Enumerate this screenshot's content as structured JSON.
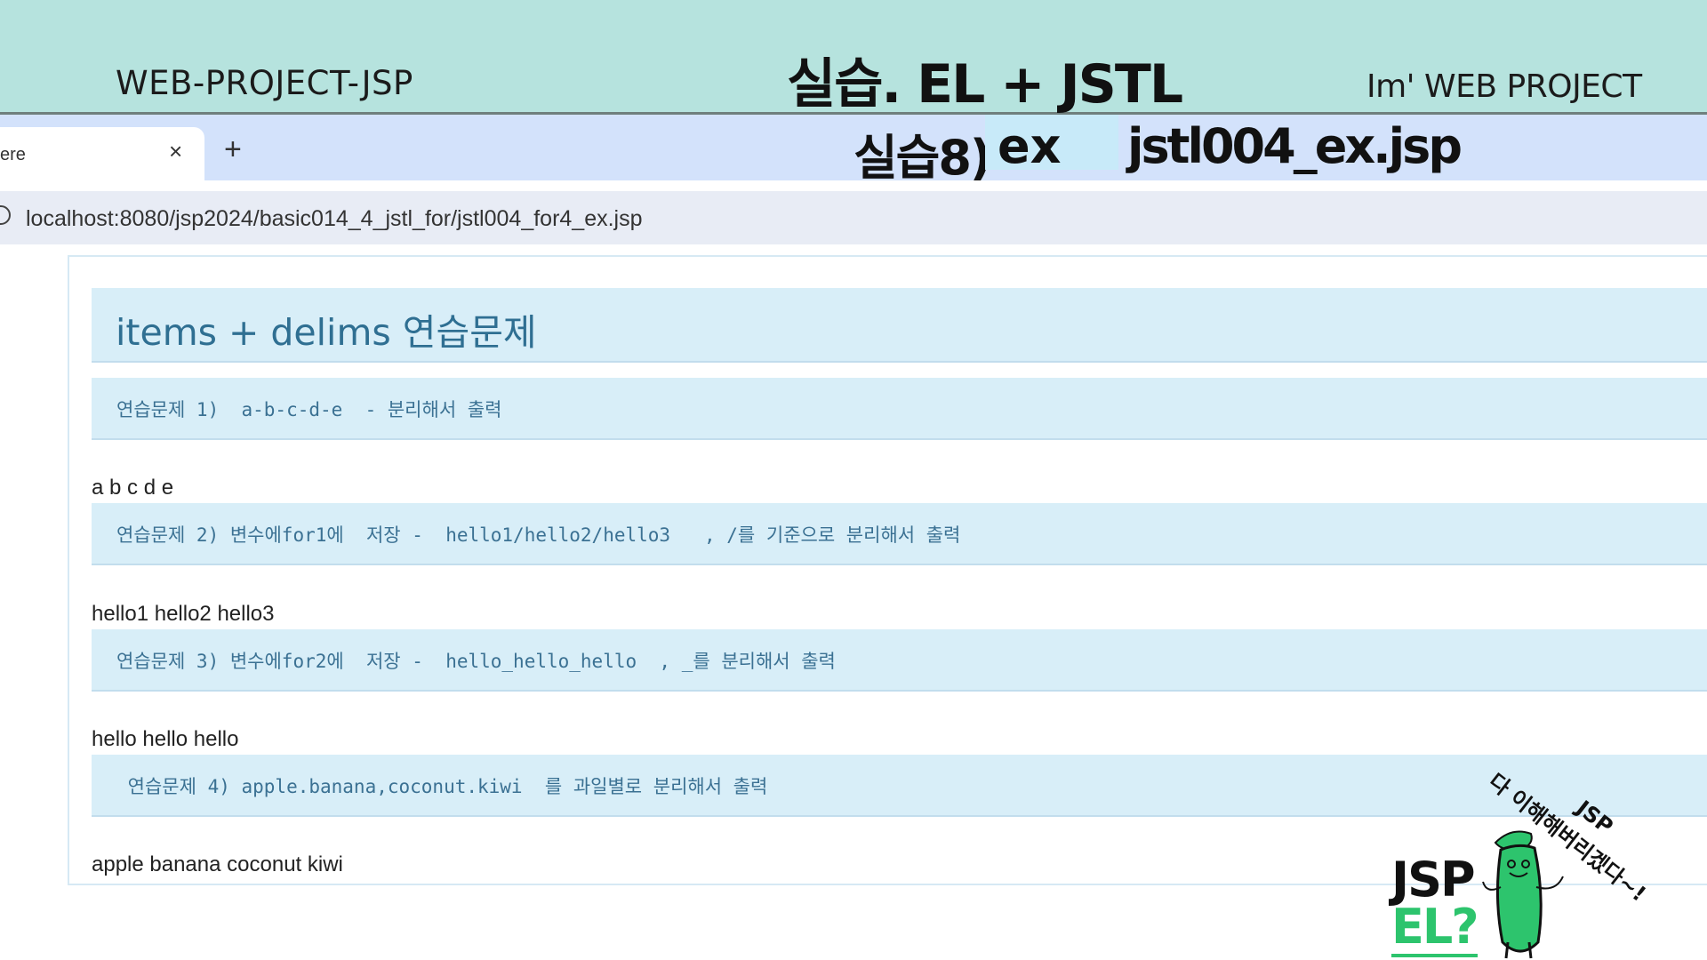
{
  "slide": {
    "left_label": "WEB-PROJECT-JSP",
    "title": "실습. EL + JSTL",
    "right_label": "Im'  WEB PROJECT",
    "practice_prefix": "실습8)",
    "practice_ex": "ex",
    "practice_file": "jstl004_ex.jsp"
  },
  "browser": {
    "tab_title": "ere",
    "tab_close": "×",
    "new_tab": "+",
    "url": "localhost:8080/jsp2024/basic014_4_jstl_for/jstl004_for4_ex.jsp"
  },
  "page": {
    "title": "items + delims 연습문제",
    "questions": [
      {
        "text": "연습문제 1)  a-b-c-d-e  - 분리해서 출력",
        "answer": "a b c d e"
      },
      {
        "text": "연습문제 2) 변수에for1에  저장 -  hello1/hello2/hello3   , /를 기준으로 분리해서 출력",
        "answer": "hello1 hello2 hello3"
      },
      {
        "text": "연습문제 3) 변수에for2에  저장 -  hello_hello_hello  , _를 분리해서 출력",
        "answer": "hello hello hello"
      },
      {
        "text": " 연습문제 4) apple.banana,coconut.kiwi  를 과일별로 분리해서 출력",
        "answer": "apple banana coconut kiwi"
      }
    ]
  },
  "mascot": {
    "jsp_label": "JSP",
    "el_label": "EL?",
    "speech": "다 이해해버리겠다~!",
    "speech_tag": "JSP",
    "accent_color": "#2dc46d"
  }
}
